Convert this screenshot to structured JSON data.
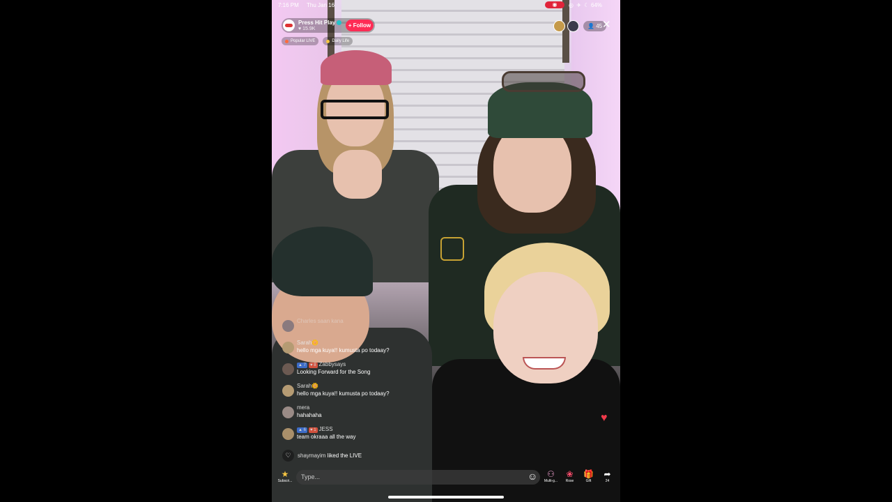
{
  "status_bar": {
    "time": "7:16 PM",
    "date": "Thu Jan 16",
    "battery": "64%",
    "icons": "◎ ✈ ☾"
  },
  "host": {
    "name": "Press Hit Play",
    "likes": "15.9K",
    "follow_label": "Follow",
    "follow_icon": "+"
  },
  "tags": [
    {
      "label": "Popular LIVE",
      "color": "#ff6a3d"
    },
    {
      "label": "Daily Life",
      "color": "#f5c542"
    }
  ],
  "viewer_count": "45",
  "close_icon": "✕",
  "chat": [
    {
      "user": "Charles saan kana",
      "text": "",
      "faded": true,
      "avatar": "#8a7a7e"
    },
    {
      "user": "Sarah🌼",
      "text": "hello mga kuya!! kumusta po todaay?",
      "avatar": "#b59b73"
    },
    {
      "user": "Zabbysays",
      "badges": [
        "7",
        "8"
      ],
      "text": "Looking Forward for the Song",
      "avatar": "#6c5a52"
    },
    {
      "user": "Sarah🌼",
      "text": "hello mga kuya!! kumusta po todaay?",
      "avatar": "#b59b73"
    },
    {
      "user": "mera",
      "text": "hahahaha",
      "avatar": "#9a8b86"
    },
    {
      "user": "JESS",
      "badges": [
        "6",
        "1"
      ],
      "text": "team okraaa all the way",
      "avatar": "#a98f6a"
    }
  ],
  "like_event": {
    "user": "shaymayim",
    "text": "liked the LIVE"
  },
  "input": {
    "placeholder": "Type..."
  },
  "bottom_actions": [
    {
      "label": "Subscri...",
      "icon": "star-icon"
    },
    {
      "label": "Multi-g...",
      "icon": "multi-guest-icon"
    },
    {
      "label": "Rose",
      "icon": "rose-icon"
    },
    {
      "label": "Gift",
      "icon": "gift-icon"
    },
    {
      "label": "24",
      "icon": "share-icon"
    }
  ]
}
